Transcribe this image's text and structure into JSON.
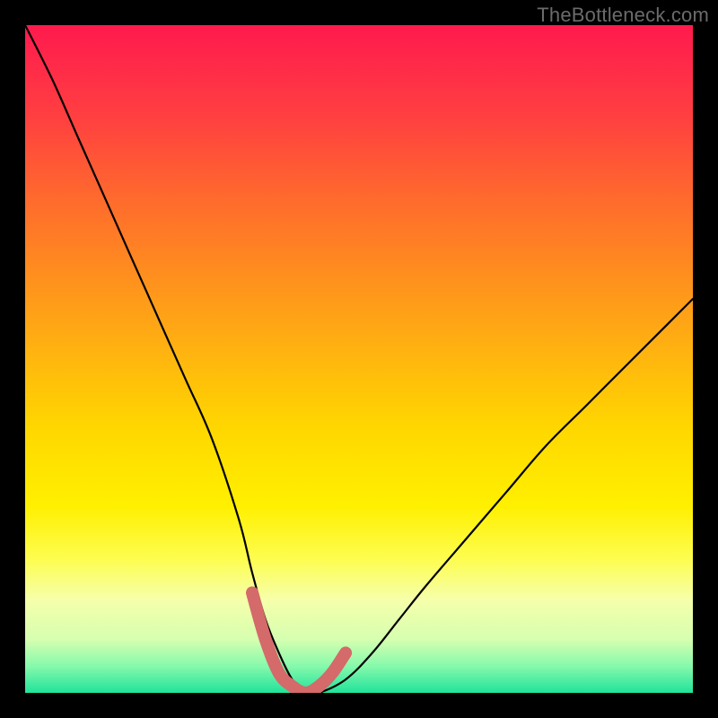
{
  "watermark": {
    "text": "TheBottleneck.com"
  },
  "colors": {
    "frame": "#000000",
    "curve_stroke": "#000000",
    "highlight_stroke": "#d46a6a"
  },
  "chart_data": {
    "type": "line",
    "title": "",
    "xlabel": "",
    "ylabel": "",
    "xlim": [
      0,
      100
    ],
    "ylim": [
      0,
      100
    ],
    "grid": false,
    "legend": false,
    "series": [
      {
        "name": "bottleneck-curve",
        "x": [
          0,
          4,
          8,
          12,
          16,
          20,
          24,
          28,
          32,
          34,
          36,
          38,
          40,
          42,
          44,
          48,
          52,
          56,
          60,
          66,
          72,
          78,
          84,
          90,
          96,
          100
        ],
        "values": [
          100,
          92,
          83,
          74,
          65,
          56,
          47,
          38,
          26,
          18,
          11,
          6,
          2,
          0,
          0,
          2,
          6,
          11,
          16,
          23,
          30,
          37,
          43,
          49,
          55,
          59
        ]
      },
      {
        "name": "optimal-highlight",
        "x": [
          34,
          36,
          38,
          40,
          42,
          44,
          46,
          48
        ],
        "values": [
          15,
          8,
          3,
          1,
          0,
          1,
          3,
          6
        ]
      }
    ]
  }
}
